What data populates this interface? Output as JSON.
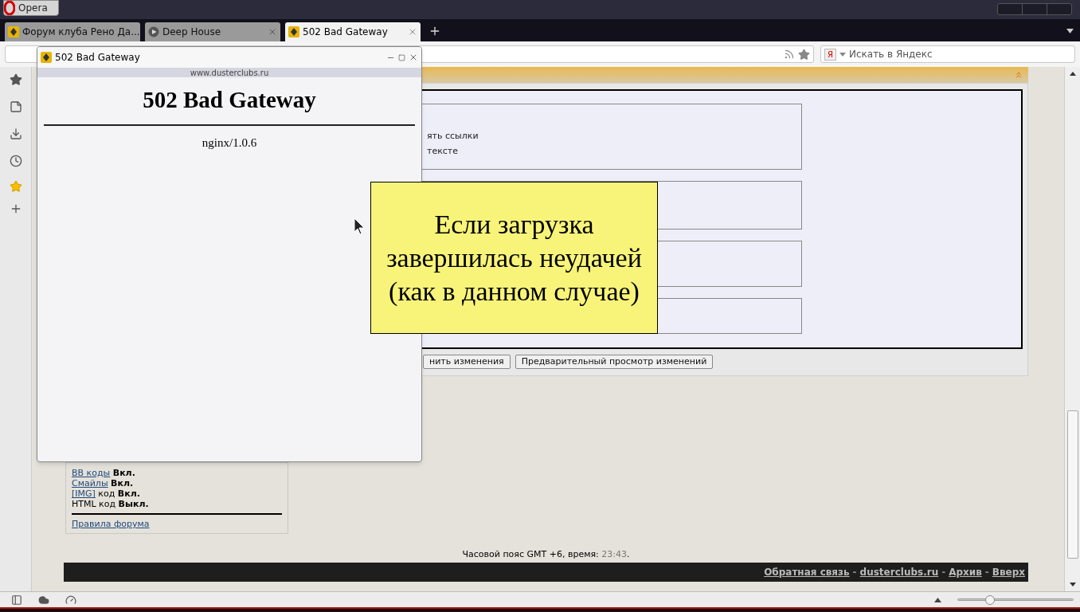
{
  "app_button": "Opera",
  "tabs": [
    {
      "label": "Форум клуба Рено Да...",
      "kind": "site",
      "selected": false
    },
    {
      "label": "Deep House",
      "kind": "media",
      "selected": false
    },
    {
      "label": "502 Bad Gateway",
      "kind": "site",
      "selected": true
    }
  ],
  "search": {
    "engine_label": "Я",
    "placeholder": "Искать в Яндекс"
  },
  "editor": {
    "lines": [
      "ять ссылки",
      "тексте"
    ],
    "buttons": [
      "нить изменения",
      "Предварительный просмотр изменений"
    ]
  },
  "info": {
    "lines": [
      [
        {
          "kind": "link",
          "text": "BB коды"
        },
        {
          "kind": "bold",
          "text": "Вкл."
        }
      ],
      [
        {
          "kind": "link",
          "text": "Смайлы"
        },
        {
          "kind": "bold",
          "text": "Вкл."
        }
      ],
      [
        {
          "kind": "link",
          "text": "[IMG]"
        },
        {
          "kind": "plain",
          "text": "код"
        },
        {
          "kind": "bold",
          "text": "Вкл."
        }
      ],
      [
        {
          "kind": "plain",
          "text": "HTML код"
        },
        {
          "kind": "bold",
          "text": "Выкл."
        }
      ]
    ],
    "rules_link": "Правила форума"
  },
  "timezone": {
    "text": "Часовой пояс GMT +6, время: ",
    "time": "23:43",
    "suffix": "."
  },
  "footer": {
    "links": [
      "Обратная связь",
      "dusterclubs.ru",
      "Архив",
      "Вверх"
    ],
    "separator": "-"
  },
  "popup": {
    "title": "502 Bad Gateway",
    "url": "www.dusterclubs.ru",
    "heading": "502 Bad Gateway",
    "server": "nginx/1.0.6"
  },
  "callout": {
    "text": "Если загрузка завершилась неудачей (как в данном случае)"
  },
  "zoom_slider": {
    "level": 0.28
  }
}
